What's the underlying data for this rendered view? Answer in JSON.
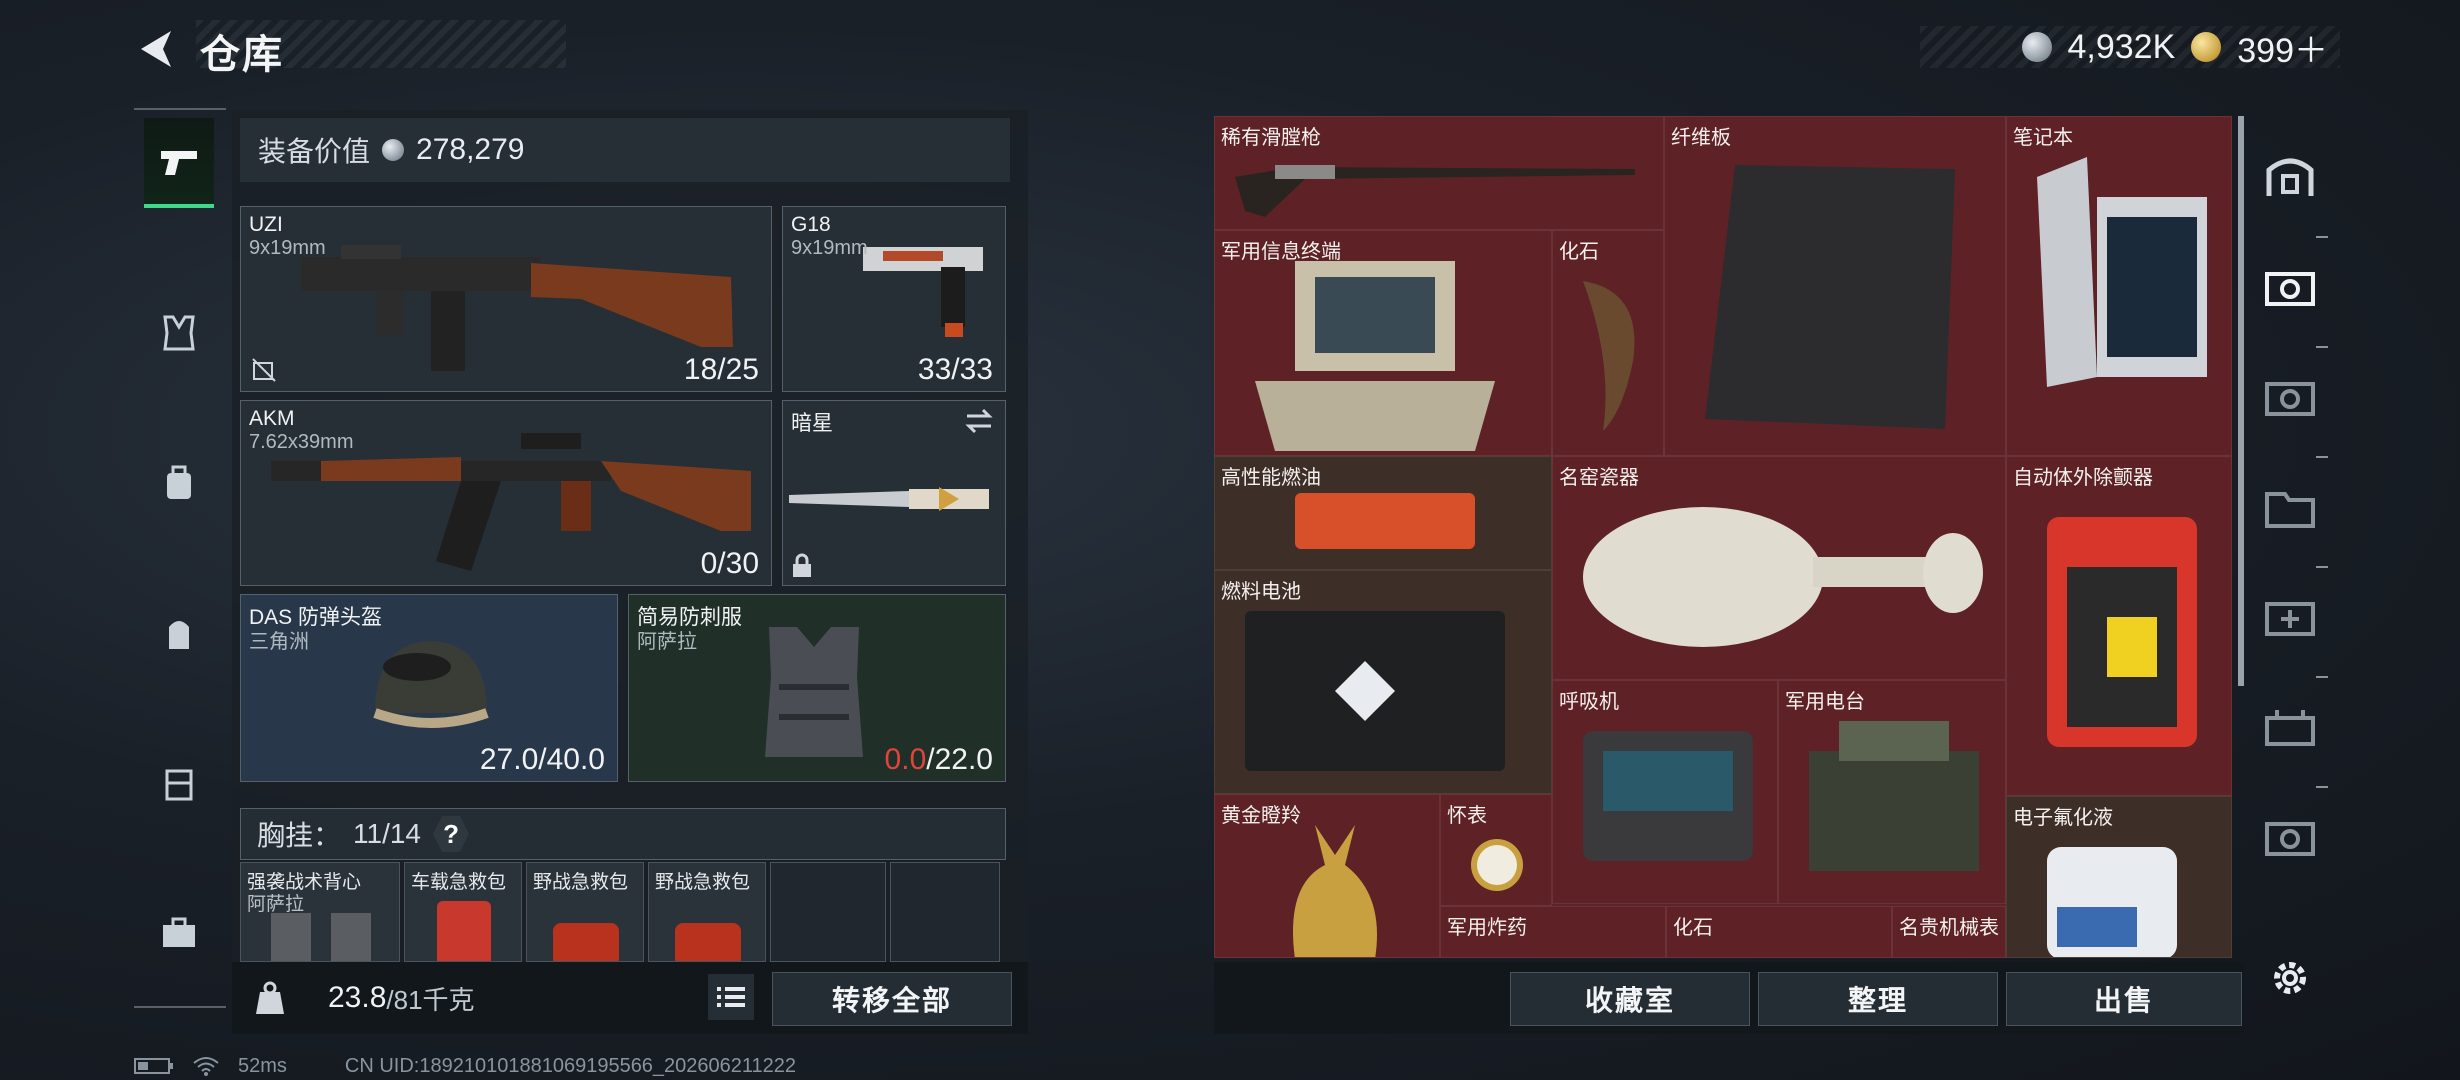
{
  "header": {
    "title": "仓库"
  },
  "currency": {
    "silver": "4,932K",
    "gold": "399＋"
  },
  "equipment": {
    "value_label": "装备价值",
    "value": "278,279",
    "slots": {
      "uzi": {
        "name": "UZI",
        "caliber": "9x19mm",
        "ammo": "18/25"
      },
      "g18": {
        "name": "G18",
        "caliber": "9x19mm",
        "ammo": "33/33"
      },
      "akm": {
        "name": "AKM",
        "caliber": "7.62x39mm",
        "ammo": "0/30"
      },
      "melee": {
        "name": "暗星"
      },
      "helmet": {
        "name": "DAS 防弹头盔",
        "sub": "三角洲",
        "durability": "27.0/40.0"
      },
      "armor": {
        "name": "简易防刺服",
        "sub": "阿萨拉",
        "durability_current": "0.0",
        "durability_max": "/22.0"
      }
    },
    "chest_rig": {
      "label": "胸挂：",
      "capacity": "11/14"
    },
    "chest_items": [
      {
        "name": "强袭战术背心",
        "sub": "阿萨拉"
      },
      {
        "name": "车载急救包",
        "sub": ""
      },
      {
        "name": "野战急救包",
        "sub": ""
      },
      {
        "name": "野战急救包",
        "sub": ""
      }
    ],
    "weight_current": "23.8",
    "weight_max": "/81千克",
    "transfer_all": "转移全部"
  },
  "storage": {
    "items": [
      {
        "name": "稀有滑膛枪"
      },
      {
        "name": "纤维板"
      },
      {
        "name": "笔记本"
      },
      {
        "name": "军用信息终端"
      },
      {
        "name": "化石"
      },
      {
        "name": "高性能燃油"
      },
      {
        "name": "名窑瓷器"
      },
      {
        "name": "自动体外除颤器"
      },
      {
        "name": "燃料电池"
      },
      {
        "name": "呼吸机"
      },
      {
        "name": "军用电台"
      },
      {
        "name": "黄金瞪羚"
      },
      {
        "name": "怀表"
      },
      {
        "name": "电子氟化液"
      },
      {
        "name": "军用炸药"
      },
      {
        "name": "化石"
      },
      {
        "name": "名贵机械表"
      }
    ],
    "buttons": {
      "collection": "收藏室",
      "sort": "整理",
      "sell": "出售"
    }
  },
  "status": {
    "ping": "52ms",
    "uid": "CN UID:189210101881069195566_202606211222"
  },
  "colors": {
    "accent": "#3fd88a",
    "storage_bg": "#5c2428",
    "warn": "#e0453a"
  }
}
